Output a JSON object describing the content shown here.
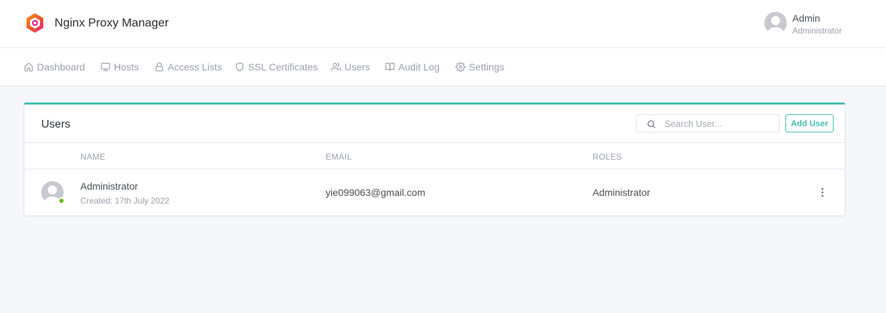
{
  "app": {
    "title": "Nginx Proxy Manager",
    "logo_icon": "hexagon-logo-icon",
    "colors": {
      "accent": "#45c1b1",
      "online": "#5eba00",
      "logo_orange": "#f15a24",
      "logo_pink": "#e91e8c"
    }
  },
  "user_menu": {
    "name": "Admin",
    "role": "Administrator",
    "avatar_icon": "user-avatar-icon"
  },
  "nav": {
    "items": [
      {
        "label": "Dashboard",
        "icon": "home-icon"
      },
      {
        "label": "Hosts",
        "icon": "monitor-icon"
      },
      {
        "label": "Access Lists",
        "icon": "lock-icon"
      },
      {
        "label": "SSL Certificates",
        "icon": "shield-icon"
      },
      {
        "label": "Users",
        "icon": "users-icon"
      },
      {
        "label": "Audit Log",
        "icon": "book-icon"
      },
      {
        "label": "Settings",
        "icon": "gear-icon"
      }
    ]
  },
  "users_card": {
    "title": "Users",
    "search_placeholder": "Search User...",
    "add_button": "Add User",
    "columns": [
      "NAME",
      "EMAIL",
      "ROLES"
    ],
    "rows": [
      {
        "name": "Administrator",
        "created": "Created: 17th July 2022",
        "email": "yie099063@gmail.com",
        "roles": "Administrator",
        "status": "online"
      }
    ]
  }
}
